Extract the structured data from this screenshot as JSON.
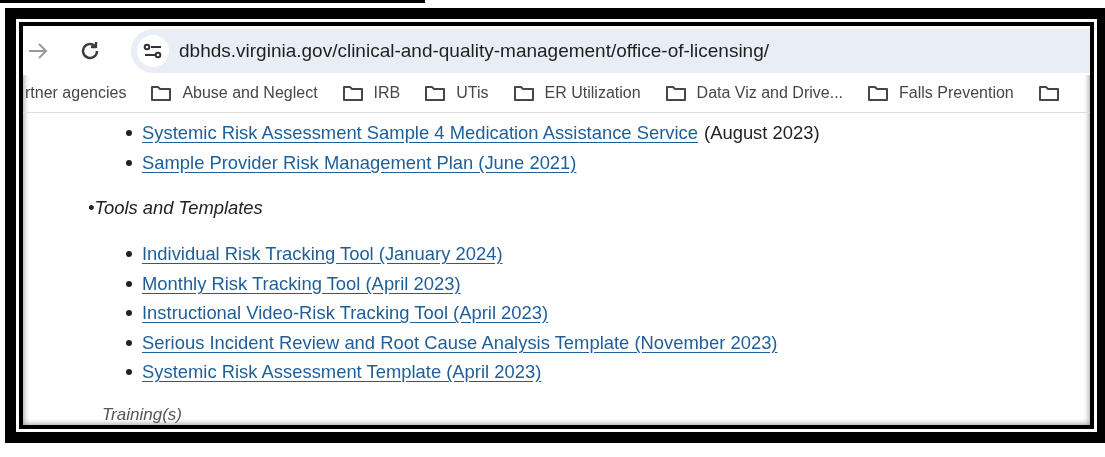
{
  "toolbar": {
    "address": "dbhds.virginia.gov/clinical-and-quality-management/office-of-licensing/"
  },
  "bookmarks": [
    {
      "kind": "partial",
      "label": "rtner agencies"
    },
    {
      "kind": "folder",
      "label": "Abuse and Neglect"
    },
    {
      "kind": "folder",
      "label": "IRB"
    },
    {
      "kind": "folder",
      "label": "UTis"
    },
    {
      "kind": "folder",
      "label": "ER Utilization"
    },
    {
      "kind": "folder",
      "label": "Data Viz and Drive..."
    },
    {
      "kind": "folder",
      "label": "Falls Prevention"
    },
    {
      "kind": "folder"
    }
  ],
  "content": [
    {
      "kind": "list",
      "items": [
        {
          "link": "Systemic Risk Assessment Sample 4 Medication Assistance Service",
          "note": "(August 2023)"
        },
        {
          "link": "Sample Provider Risk Management Plan (June 2021)"
        }
      ]
    },
    {
      "kind": "heading",
      "text": "•Tools and Templates"
    },
    {
      "kind": "list",
      "items": [
        {
          "link": "Individual Risk Tracking Tool (January 2024)"
        },
        {
          "link": "Monthly Risk Tracking Tool (April 2023)"
        },
        {
          "link": "Instructional Video-Risk Tracking Tool (April 2023)"
        },
        {
          "link": "Serious Incident Review and Root Cause Analysis Template (November 2023) "
        },
        {
          "link": "Systemic Risk Assessment Template (April 2023)"
        }
      ]
    },
    {
      "kind": "cut-heading",
      "text": "Training(s)"
    }
  ]
}
